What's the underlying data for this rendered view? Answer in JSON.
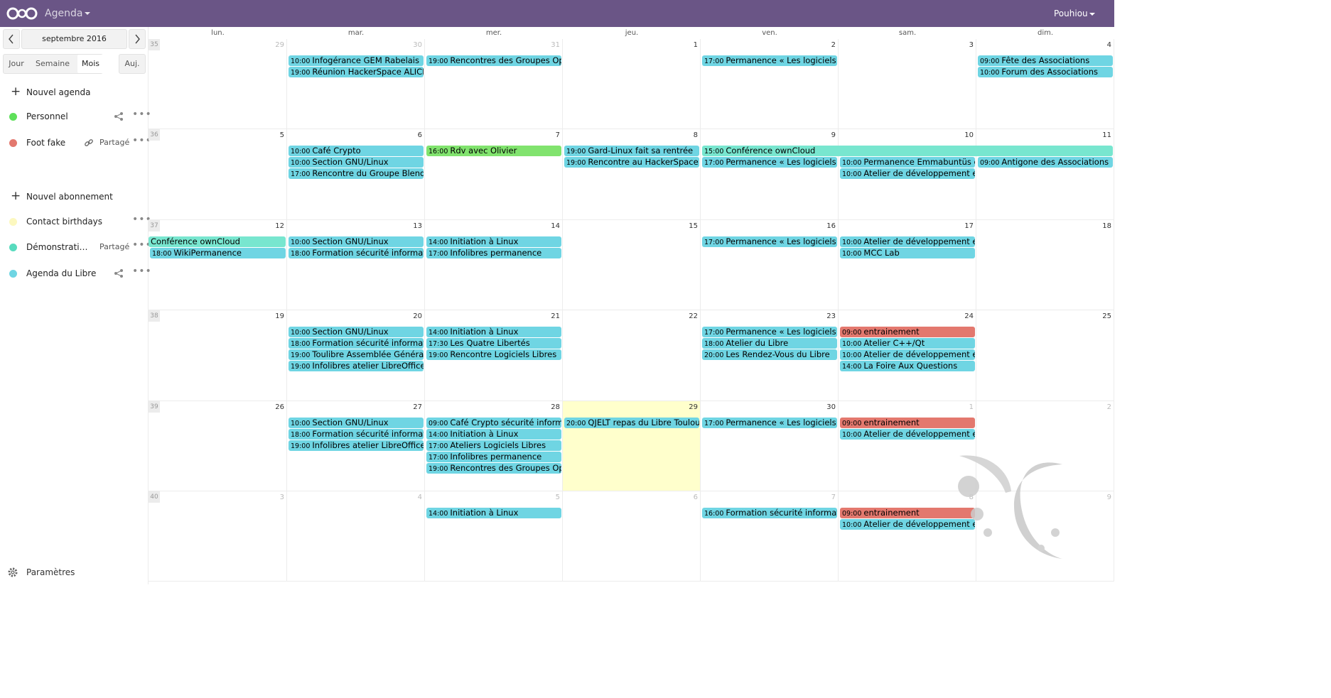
{
  "header": {
    "app_title": "Agenda",
    "user_name": "Pouhiou",
    "color": "#6a5586"
  },
  "sidebar": {
    "prev_icon": "chevron-left-icon",
    "next_icon": "chevron-right-icon",
    "month_label": "septembre 2016",
    "views": {
      "day": "Jour",
      "week": "Semaine",
      "month": "Mois",
      "active": "Mois"
    },
    "today_label": "Auj.",
    "new_calendar": "Nouvel agenda",
    "calendars": [
      {
        "label": "Personnel",
        "color": "#5ee05a",
        "shared": "",
        "share_icon": true
      },
      {
        "label": "Foot fake",
        "color": "#e3786e",
        "shared": "Partagé",
        "link_icon": true
      }
    ],
    "new_subscription": "Nouvel abonnement",
    "subscriptions": [
      {
        "label": "Contact birthdays",
        "color": "#fcf8bf",
        "shared": ""
      },
      {
        "label": "Démonstrati…",
        "color": "#58dbbe",
        "shared": "Partagé"
      },
      {
        "label": "Agenda du Libre",
        "color": "#6fd5e3",
        "shared": "",
        "share_icon": true
      }
    ],
    "settings_label": "Paramètres"
  },
  "calendar": {
    "days_of_week": [
      "lun.",
      "mar.",
      "mer.",
      "jeu.",
      "ven.",
      "sam.",
      "dim."
    ],
    "weeks": [
      {
        "number": "35",
        "days": [
          {
            "n": "29",
            "other": true
          },
          {
            "n": "30",
            "other": true
          },
          {
            "n": "31",
            "other": true
          },
          {
            "n": "1"
          },
          {
            "n": "2"
          },
          {
            "n": "3"
          },
          {
            "n": "4"
          }
        ]
      },
      {
        "number": "36",
        "days": [
          {
            "n": "5"
          },
          {
            "n": "6"
          },
          {
            "n": "7"
          },
          {
            "n": "8"
          },
          {
            "n": "9"
          },
          {
            "n": "10"
          },
          {
            "n": "11"
          }
        ]
      },
      {
        "number": "37",
        "days": [
          {
            "n": "12"
          },
          {
            "n": "13"
          },
          {
            "n": "14"
          },
          {
            "n": "15"
          },
          {
            "n": "16"
          },
          {
            "n": "17"
          },
          {
            "n": "18"
          }
        ]
      },
      {
        "number": "38",
        "days": [
          {
            "n": "19"
          },
          {
            "n": "20"
          },
          {
            "n": "21"
          },
          {
            "n": "22"
          },
          {
            "n": "23"
          },
          {
            "n": "24"
          },
          {
            "n": "25"
          }
        ]
      },
      {
        "number": "39",
        "days": [
          {
            "n": "26"
          },
          {
            "n": "27"
          },
          {
            "n": "28"
          },
          {
            "n": "29",
            "today": true
          },
          {
            "n": "30"
          },
          {
            "n": "1",
            "other": true
          },
          {
            "n": "2",
            "other": true
          }
        ]
      },
      {
        "number": "40",
        "days": [
          {
            "n": "3",
            "other": true
          },
          {
            "n": "4",
            "other": true
          },
          {
            "n": "5",
            "other": true
          },
          {
            "n": "6",
            "other": true
          },
          {
            "n": "7",
            "other": true
          },
          {
            "n": "8",
            "other": true
          },
          {
            "n": "9",
            "other": true
          }
        ]
      }
    ],
    "events": [
      {
        "week": 0,
        "day": 1,
        "slot": 0,
        "time": "10:00",
        "title": "Infogérance GEM Rabelais",
        "cal": "libre"
      },
      {
        "week": 0,
        "day": 1,
        "slot": 1,
        "time": "19:00",
        "title": "Réunion HackerSpace ALICEL",
        "cal": "libre"
      },
      {
        "week": 0,
        "day": 2,
        "slot": 0,
        "time": "19:00",
        "title": "Rencontres des Groupes Open",
        "cal": "libre"
      },
      {
        "week": 0,
        "day": 4,
        "slot": 0,
        "time": "17:00",
        "title": "Permanence « Les logiciels libres",
        "cal": "libre"
      },
      {
        "week": 0,
        "day": 6,
        "slot": 0,
        "time": "09:00",
        "title": "Fête des Associations",
        "cal": "libre"
      },
      {
        "week": 0,
        "day": 6,
        "slot": 1,
        "time": "10:00",
        "title": "Forum des Associations",
        "cal": "libre"
      },
      {
        "week": 1,
        "day": 1,
        "slot": 0,
        "time": "10:00",
        "title": "Café Crypto",
        "cal": "libre"
      },
      {
        "week": 1,
        "day": 1,
        "slot": 1,
        "time": "10:00",
        "title": "Section GNU/Linux",
        "cal": "libre"
      },
      {
        "week": 1,
        "day": 1,
        "slot": 2,
        "time": "17:00",
        "title": "Rencontre du Groupe Blender",
        "cal": "libre"
      },
      {
        "week": 1,
        "day": 2,
        "slot": 0,
        "time": "16:00",
        "title": "Rdv avec Olivier",
        "cal": "perso"
      },
      {
        "week": 1,
        "day": 3,
        "slot": 0,
        "time": "19:00",
        "title": "Gard-Linux fait sa rentrée",
        "cal": "libre"
      },
      {
        "week": 1,
        "day": 3,
        "slot": 1,
        "time": "19:00",
        "title": "Rencontre au HackerSpace",
        "cal": "libre"
      },
      {
        "week": 1,
        "day": 4,
        "slot": 0,
        "span": 3,
        "time": "15:00",
        "title": "Conférence ownCloud",
        "cal": "demo"
      },
      {
        "week": 1,
        "day": 4,
        "slot": 1,
        "time": "17:00",
        "title": "Permanence « Les logiciels libres",
        "cal": "libre"
      },
      {
        "week": 1,
        "day": 5,
        "slot": 1,
        "time": "10:00",
        "title": "Permanence Emmabuntüs et",
        "cal": "libre"
      },
      {
        "week": 1,
        "day": 5,
        "slot": 2,
        "time": "10:00",
        "title": "Atelier de développement et",
        "cal": "libre"
      },
      {
        "week": 1,
        "day": 6,
        "slot": 1,
        "time": "09:00",
        "title": "Antigone des Associations",
        "cal": "libre"
      },
      {
        "week": 2,
        "day": 0,
        "slot": 0,
        "time": "",
        "title": "Conférence ownCloud",
        "cal": "demo",
        "cont": true
      },
      {
        "week": 2,
        "day": 0,
        "slot": 1,
        "time": "18:00",
        "title": "WikiPermanence",
        "cal": "libre"
      },
      {
        "week": 2,
        "day": 1,
        "slot": 0,
        "time": "10:00",
        "title": "Section GNU/Linux",
        "cal": "libre"
      },
      {
        "week": 2,
        "day": 1,
        "slot": 1,
        "time": "18:00",
        "title": "Formation sécurité informatique",
        "cal": "libre"
      },
      {
        "week": 2,
        "day": 2,
        "slot": 0,
        "time": "14:00",
        "title": "Initiation à Linux",
        "cal": "libre"
      },
      {
        "week": 2,
        "day": 2,
        "slot": 1,
        "time": "17:00",
        "title": "Infolibres permanence",
        "cal": "libre"
      },
      {
        "week": 2,
        "day": 4,
        "slot": 0,
        "time": "17:00",
        "title": "Permanence « Les logiciels libres",
        "cal": "libre"
      },
      {
        "week": 2,
        "day": 5,
        "slot": 0,
        "time": "10:00",
        "title": "Atelier de développement et",
        "cal": "libre"
      },
      {
        "week": 2,
        "day": 5,
        "slot": 1,
        "time": "10:00",
        "title": "MCC Lab",
        "cal": "libre"
      },
      {
        "week": 3,
        "day": 1,
        "slot": 0,
        "time": "10:00",
        "title": "Section GNU/Linux",
        "cal": "libre"
      },
      {
        "week": 3,
        "day": 1,
        "slot": 1,
        "time": "18:00",
        "title": "Formation sécurité informatique",
        "cal": "libre"
      },
      {
        "week": 3,
        "day": 1,
        "slot": 2,
        "time": "19:00",
        "title": "Toulibre Assemblée Générale",
        "cal": "libre"
      },
      {
        "week": 3,
        "day": 1,
        "slot": 3,
        "time": "19:00",
        "title": "Infolibres atelier LibreOffice Calc",
        "cal": "libre"
      },
      {
        "week": 3,
        "day": 2,
        "slot": 0,
        "time": "14:00",
        "title": "Initiation à Linux",
        "cal": "libre"
      },
      {
        "week": 3,
        "day": 2,
        "slot": 1,
        "time": "17:30",
        "title": "Les Quatre Libertés",
        "cal": "libre"
      },
      {
        "week": 3,
        "day": 2,
        "slot": 2,
        "time": "19:00",
        "title": "Rencontre Logiciels Libres",
        "cal": "libre"
      },
      {
        "week": 3,
        "day": 4,
        "slot": 0,
        "time": "17:00",
        "title": "Permanence « Les logiciels libres",
        "cal": "libre"
      },
      {
        "week": 3,
        "day": 4,
        "slot": 1,
        "time": "18:00",
        "title": "Atelier du Libre",
        "cal": "libre"
      },
      {
        "week": 3,
        "day": 4,
        "slot": 2,
        "time": "20:00",
        "title": "Les Rendez-Vous du Libre",
        "cal": "libre"
      },
      {
        "week": 3,
        "day": 5,
        "slot": 0,
        "time": "09:00",
        "title": "entrainement",
        "cal": "foot"
      },
      {
        "week": 3,
        "day": 5,
        "slot": 1,
        "time": "10:00",
        "title": "Atelier C++/Qt",
        "cal": "libre"
      },
      {
        "week": 3,
        "day": 5,
        "slot": 2,
        "time": "10:00",
        "title": "Atelier de développement et",
        "cal": "libre"
      },
      {
        "week": 3,
        "day": 5,
        "slot": 3,
        "time": "14:00",
        "title": "La Foire Aux Questions",
        "cal": "libre"
      },
      {
        "week": 4,
        "day": 1,
        "slot": 0,
        "time": "10:00",
        "title": "Section GNU/Linux",
        "cal": "libre"
      },
      {
        "week": 4,
        "day": 1,
        "slot": 1,
        "time": "18:00",
        "title": "Formation sécurité informatique",
        "cal": "libre"
      },
      {
        "week": 4,
        "day": 1,
        "slot": 2,
        "time": "19:00",
        "title": "Infolibres atelier LibreOffice Calc",
        "cal": "libre"
      },
      {
        "week": 4,
        "day": 2,
        "slot": 0,
        "time": "09:00",
        "title": "Café Crypto sécurité informatique",
        "cal": "libre"
      },
      {
        "week": 4,
        "day": 2,
        "slot": 1,
        "time": "14:00",
        "title": "Initiation à Linux",
        "cal": "libre"
      },
      {
        "week": 4,
        "day": 2,
        "slot": 2,
        "time": "17:00",
        "title": "Ateliers Logiciels Libres",
        "cal": "libre"
      },
      {
        "week": 4,
        "day": 2,
        "slot": 3,
        "time": "17:00",
        "title": "Infolibres permanence",
        "cal": "libre"
      },
      {
        "week": 4,
        "day": 2,
        "slot": 4,
        "time": "19:00",
        "title": "Rencontres des Groupes Open",
        "cal": "libre"
      },
      {
        "week": 4,
        "day": 3,
        "slot": 0,
        "time": "20:00",
        "title": "QJELT repas du Libre Toulousain",
        "cal": "libre"
      },
      {
        "week": 4,
        "day": 4,
        "slot": 0,
        "time": "17:00",
        "title": "Permanence « Les logiciels libres",
        "cal": "libre"
      },
      {
        "week": 4,
        "day": 5,
        "slot": 0,
        "time": "09:00",
        "title": "entrainement",
        "cal": "foot"
      },
      {
        "week": 4,
        "day": 5,
        "slot": 1,
        "time": "10:00",
        "title": "Atelier de développement et",
        "cal": "libre"
      },
      {
        "week": 5,
        "day": 2,
        "slot": 0,
        "time": "14:00",
        "title": "Initiation à Linux",
        "cal": "libre"
      },
      {
        "week": 5,
        "day": 4,
        "slot": 0,
        "time": "16:00",
        "title": "Formation sécurité informatique",
        "cal": "libre"
      },
      {
        "week": 5,
        "day": 5,
        "slot": 0,
        "time": "09:00",
        "title": "entrainement",
        "cal": "foot"
      },
      {
        "week": 5,
        "day": 5,
        "slot": 1,
        "time": "10:00",
        "title": "Atelier de développement et",
        "cal": "libre"
      }
    ]
  }
}
